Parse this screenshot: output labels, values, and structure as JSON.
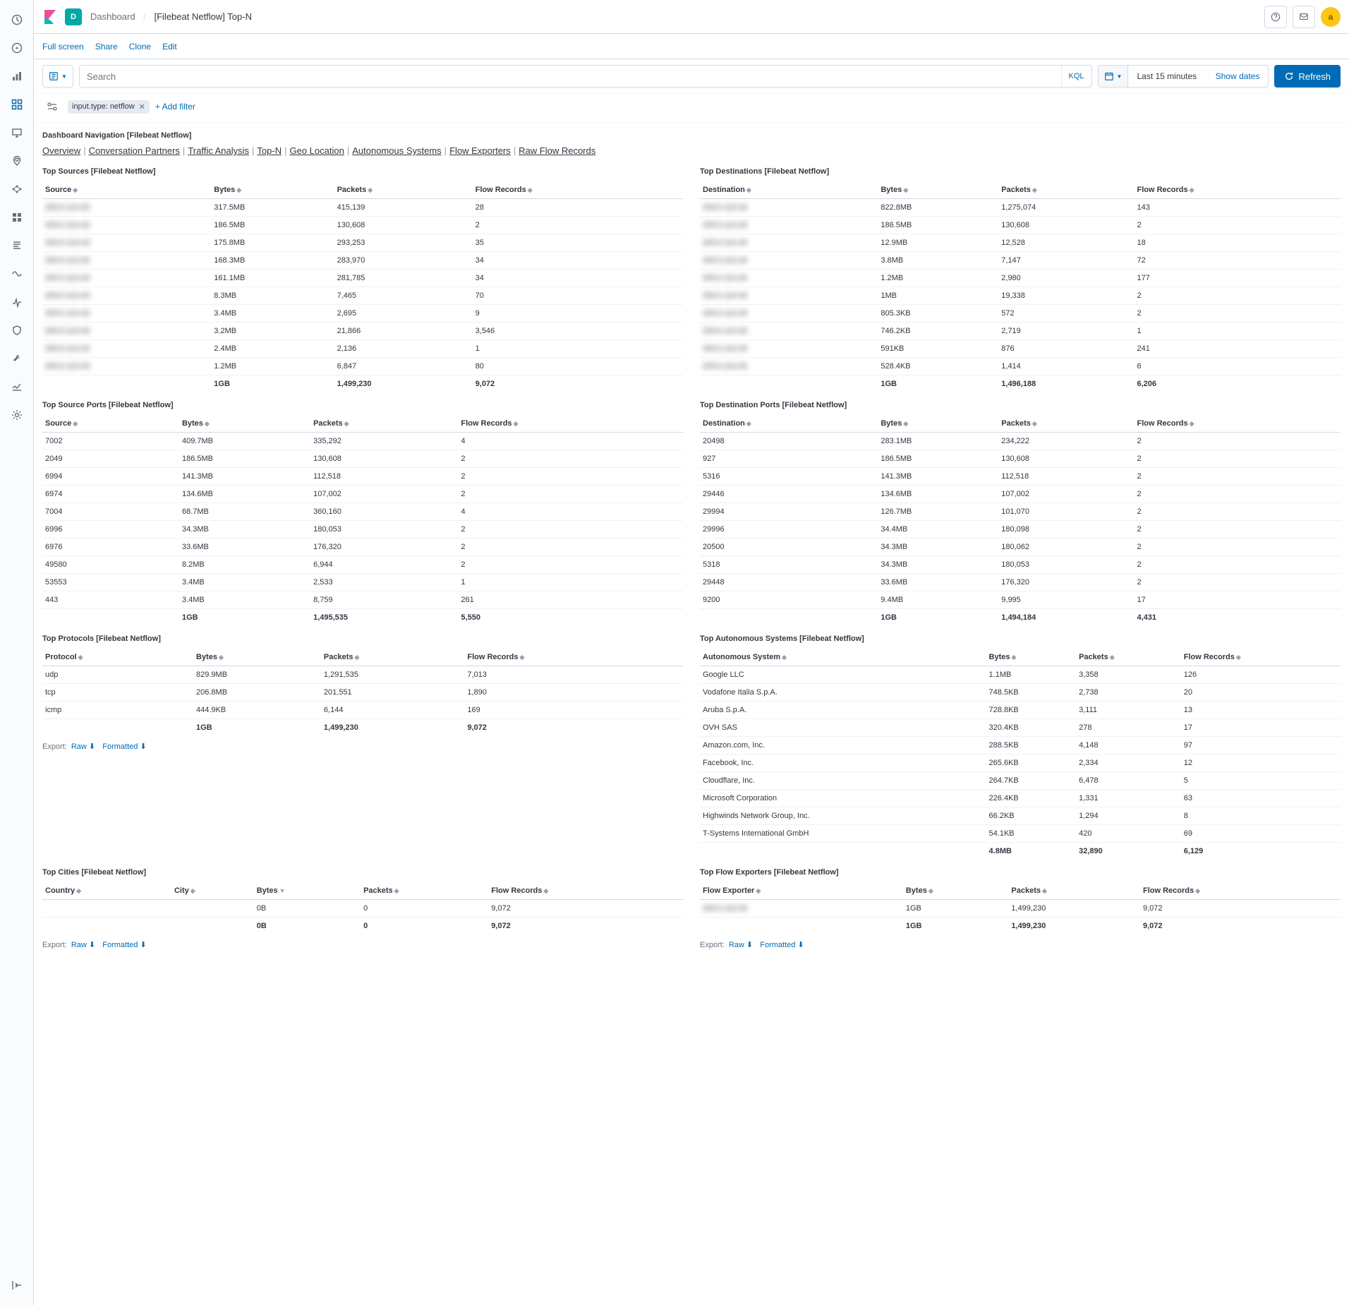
{
  "topbar": {
    "app_initial": "D",
    "breadcrumb_root": "Dashboard",
    "breadcrumb_current": "[Filebeat Netflow] Top-N",
    "avatar_initial": "a"
  },
  "menu": {
    "full_screen": "Full screen",
    "share": "Share",
    "clone": "Clone",
    "edit": "Edit"
  },
  "search": {
    "placeholder": "Search",
    "kql": "KQL",
    "time_range": "Last 15 minutes",
    "show_dates": "Show dates",
    "refresh": "Refresh"
  },
  "filters": {
    "pill_text": "input.type: netflow",
    "add_filter": "+ Add filter"
  },
  "nav_title": "Dashboard Navigation [Filebeat Netflow]",
  "nav_links": [
    "Overview",
    "Conversation Partners",
    "Traffic Analysis",
    "Top-N",
    "Geo Location",
    "Autonomous Systems",
    "Flow Exporters",
    "Raw Flow Records"
  ],
  "export": {
    "label": "Export:",
    "raw": "Raw",
    "formatted": "Formatted"
  },
  "panels": {
    "top_sources": {
      "title": "Top Sources [Filebeat Netflow]",
      "columns": [
        "Source",
        "Bytes",
        "Packets",
        "Flow Records"
      ],
      "rows": [
        [
          "███████",
          "317.5MB",
          "415,139",
          "28"
        ],
        [
          "███████",
          "186.5MB",
          "130,608",
          "2"
        ],
        [
          "███████",
          "175.8MB",
          "293,253",
          "35"
        ],
        [
          "███████",
          "168.3MB",
          "283,970",
          "34"
        ],
        [
          "███████",
          "161.1MB",
          "281,785",
          "34"
        ],
        [
          "███████",
          "8.3MB",
          "7,465",
          "70"
        ],
        [
          "███████",
          "3.4MB",
          "2,695",
          "9"
        ],
        [
          "███████",
          "3.2MB",
          "21,866",
          "3,546"
        ],
        [
          "███████",
          "2.4MB",
          "2,136",
          "1"
        ],
        [
          "███████",
          "1.2MB",
          "6,847",
          "80"
        ]
      ],
      "total": [
        "",
        "1GB",
        "1,499,230",
        "9,072"
      ]
    },
    "top_destinations": {
      "title": "Top Destinations [Filebeat Netflow]",
      "columns": [
        "Destination",
        "Bytes",
        "Packets",
        "Flow Records"
      ],
      "rows": [
        [
          "███████",
          "822.8MB",
          "1,275,074",
          "143"
        ],
        [
          "███████",
          "186.5MB",
          "130,608",
          "2"
        ],
        [
          "███████",
          "12.9MB",
          "12,528",
          "18"
        ],
        [
          "███████",
          "3.8MB",
          "7,147",
          "72"
        ],
        [
          "███████",
          "1.2MB",
          "2,980",
          "177"
        ],
        [
          "███████",
          "1MB",
          "19,338",
          "2"
        ],
        [
          "███████",
          "805.3KB",
          "572",
          "2"
        ],
        [
          "███████",
          "746.2KB",
          "2,719",
          "1"
        ],
        [
          "███████",
          "591KB",
          "876",
          "241"
        ],
        [
          "███████",
          "528.4KB",
          "1,414",
          "6"
        ]
      ],
      "total": [
        "",
        "1GB",
        "1,496,188",
        "6,206"
      ]
    },
    "top_source_ports": {
      "title": "Top Source Ports [Filebeat Netflow]",
      "columns": [
        "Source",
        "Bytes",
        "Packets",
        "Flow Records"
      ],
      "rows": [
        [
          "7002",
          "409.7MB",
          "335,292",
          "4"
        ],
        [
          "2049",
          "186.5MB",
          "130,608",
          "2"
        ],
        [
          "6994",
          "141.3MB",
          "112,518",
          "2"
        ],
        [
          "6974",
          "134.6MB",
          "107,002",
          "2"
        ],
        [
          "7004",
          "68.7MB",
          "360,160",
          "4"
        ],
        [
          "6996",
          "34.3MB",
          "180,053",
          "2"
        ],
        [
          "6976",
          "33.6MB",
          "176,320",
          "2"
        ],
        [
          "49580",
          "8.2MB",
          "6,944",
          "2"
        ],
        [
          "53553",
          "3.4MB",
          "2,533",
          "1"
        ],
        [
          "443",
          "3.4MB",
          "8,759",
          "261"
        ]
      ],
      "total": [
        "",
        "1GB",
        "1,495,535",
        "5,550"
      ]
    },
    "top_destination_ports": {
      "title": "Top Destination Ports [Filebeat Netflow]",
      "columns": [
        "Destination",
        "Bytes",
        "Packets",
        "Flow Records"
      ],
      "rows": [
        [
          "20498",
          "283.1MB",
          "234,222",
          "2"
        ],
        [
          "927",
          "186.5MB",
          "130,608",
          "2"
        ],
        [
          "5316",
          "141.3MB",
          "112,518",
          "2"
        ],
        [
          "29446",
          "134.6MB",
          "107,002",
          "2"
        ],
        [
          "29994",
          "126.7MB",
          "101,070",
          "2"
        ],
        [
          "29996",
          "34.4MB",
          "180,098",
          "2"
        ],
        [
          "20500",
          "34.3MB",
          "180,062",
          "2"
        ],
        [
          "5318",
          "34.3MB",
          "180,053",
          "2"
        ],
        [
          "29448",
          "33.6MB",
          "176,320",
          "2"
        ],
        [
          "9200",
          "9.4MB",
          "9,995",
          "17"
        ]
      ],
      "total": [
        "",
        "1GB",
        "1,494,184",
        "4,431"
      ]
    },
    "top_protocols": {
      "title": "Top Protocols [Filebeat Netflow]",
      "columns": [
        "Protocol",
        "Bytes",
        "Packets",
        "Flow Records"
      ],
      "rows": [
        [
          "udp",
          "829.9MB",
          "1,291,535",
          "7,013"
        ],
        [
          "tcp",
          "206.8MB",
          "201,551",
          "1,890"
        ],
        [
          "icmp",
          "444.9KB",
          "6,144",
          "169"
        ]
      ],
      "total": [
        "",
        "1GB",
        "1,499,230",
        "9,072"
      ],
      "has_export": true
    },
    "top_as": {
      "title": "Top Autonomous Systems [Filebeat Netflow]",
      "columns": [
        "Autonomous System",
        "Bytes",
        "Packets",
        "Flow Records"
      ],
      "rows": [
        [
          "Google LLC",
          "1.1MB",
          "3,358",
          "126"
        ],
        [
          "Vodafone Italia S.p.A.",
          "748.5KB",
          "2,738",
          "20"
        ],
        [
          "Aruba S.p.A.",
          "728.8KB",
          "3,111",
          "13"
        ],
        [
          "OVH SAS",
          "320.4KB",
          "278",
          "17"
        ],
        [
          "Amazon.com, Inc.",
          "288.5KB",
          "4,148",
          "97"
        ],
        [
          "Facebook, Inc.",
          "265.6KB",
          "2,334",
          "12"
        ],
        [
          "Cloudflare, Inc.",
          "264.7KB",
          "6,478",
          "5"
        ],
        [
          "Microsoft Corporation",
          "226.4KB",
          "1,331",
          "63"
        ],
        [
          "Highwinds Network Group, Inc.",
          "66.2KB",
          "1,294",
          "8"
        ],
        [
          "T-Systems International GmbH",
          "54.1KB",
          "420",
          "69"
        ]
      ],
      "total": [
        "",
        "4.8MB",
        "32,890",
        "6,129"
      ]
    },
    "top_cities": {
      "title": "Top Cities [Filebeat Netflow]",
      "columns": [
        "Country",
        "City",
        "Bytes",
        "Packets",
        "Flow Records"
      ],
      "rows": [
        [
          "",
          "",
          "0B",
          "0",
          "9,072"
        ]
      ],
      "total": [
        "",
        "",
        "0B",
        "0",
        "9,072"
      ],
      "has_export": true,
      "sorted_col": 2
    },
    "top_flow_exporters": {
      "title": "Top Flow Exporters [Filebeat Netflow]",
      "columns": [
        "Flow Exporter",
        "Bytes",
        "Packets",
        "Flow Records"
      ],
      "rows": [
        [
          "███████",
          "1GB",
          "1,499,230",
          "9,072"
        ]
      ],
      "total": [
        "",
        "1GB",
        "1,499,230",
        "9,072"
      ],
      "has_export": true
    }
  }
}
